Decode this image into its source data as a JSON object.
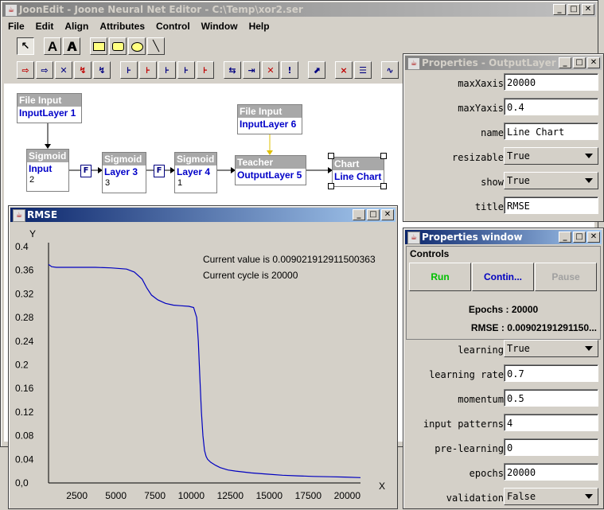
{
  "main_window": {
    "title": "JoonEdit - Joone Neural Net Editor - C:\\Temp\\xor2.ser",
    "menus": [
      "File",
      "Edit",
      "Align",
      "Attributes",
      "Control",
      "Window",
      "Help"
    ]
  },
  "toolbar": {
    "row1": [
      "arrow-select-tool",
      "text-tool",
      "bold-text-tool",
      "rectangle-tool",
      "rounded-rectangle-tool",
      "ellipse-tool",
      "line-tool"
    ],
    "row1_labels": [
      "",
      "A",
      "A"
    ],
    "row2": [
      "file-input-tool",
      "url-input-tool",
      "excel-input-tool",
      "switch-tool",
      "learning-switch-tool",
      "linear-layer-tool",
      "sigmoid-layer-tool",
      "tanh-layer-tool",
      "logarithmic-layer-tool",
      "context-layer-tool",
      "full-synapse-tool",
      "direct-synapse-tool",
      "delay-synapse-tool",
      "kohonen-synapse-tool",
      "chart-tool",
      "teacher-tool",
      "output-tool",
      "wave-tool"
    ]
  },
  "network": {
    "nodes": [
      {
        "header": "File Input",
        "name": "InputLayer 1",
        "count": ""
      },
      {
        "header": "Sigmoid",
        "name": "Input",
        "count": "2"
      },
      {
        "header": "Sigmoid",
        "name": "Layer 3",
        "count": "3"
      },
      {
        "header": "Sigmoid",
        "name": "Layer 4",
        "count": "1"
      },
      {
        "header": "File Input",
        "name": "InputLayer 6",
        "count": ""
      },
      {
        "header": "Teacher",
        "name": "OutputLayer 5",
        "count": ""
      },
      {
        "header": "Chart",
        "name": "Line Chart",
        "count": ""
      }
    ],
    "synapse_label": "F"
  },
  "rmse_window": {
    "title": "RMSE",
    "y_axis_label": "Y",
    "x_axis_label": "X",
    "current_value_text": "Current value is 0.009021912911500363",
    "current_cycle_text": "Current cycle is 20000"
  },
  "chart_data": {
    "type": "line",
    "title": "RMSE",
    "xlabel": "X",
    "ylabel": "Y",
    "xlim": [
      0,
      20000
    ],
    "ylim": [
      0,
      0.4
    ],
    "x_ticks": [
      "2500",
      "5000",
      "7500",
      "10000",
      "12500",
      "15000",
      "17500",
      "20000"
    ],
    "y_ticks": [
      "0,0",
      "0.04",
      "0.08",
      "0.12",
      "0.16",
      "0.2",
      "0.24",
      "0.28",
      "0.32",
      "0.36",
      "0.4"
    ],
    "line_color": "#0000c0",
    "series": [
      {
        "x": [
          0,
          200,
          500,
          1000,
          2000,
          3000,
          4000,
          5000,
          5500,
          6000,
          6300,
          6600,
          7000,
          7500,
          8000,
          8500,
          9000,
          9300,
          9500,
          9600,
          9700,
          9800,
          9900,
          10000,
          10100,
          10200,
          10400,
          10700,
          11000,
          11500,
          12000,
          13000,
          14000,
          15000,
          16000,
          17000,
          18000,
          19000,
          20000
        ],
        "y": [
          0.37,
          0.366,
          0.365,
          0.365,
          0.365,
          0.365,
          0.364,
          0.362,
          0.357,
          0.345,
          0.33,
          0.318,
          0.31,
          0.304,
          0.301,
          0.3,
          0.299,
          0.297,
          0.28,
          0.24,
          0.18,
          0.12,
          0.08,
          0.055,
          0.045,
          0.04,
          0.035,
          0.03,
          0.026,
          0.022,
          0.02,
          0.017,
          0.015,
          0.013,
          0.012,
          0.011,
          0.0105,
          0.01,
          0.009
        ]
      }
    ]
  },
  "output_props": {
    "title": "Properties - OutputLayer 1",
    "rows": [
      {
        "label": "maxXaxis",
        "value": "20000",
        "kind": "field"
      },
      {
        "label": "maxYaxis",
        "value": "0.4",
        "kind": "field"
      },
      {
        "label": "name",
        "value": "Line Chart",
        "kind": "field"
      },
      {
        "label": "resizable",
        "value": "True",
        "kind": "combo"
      },
      {
        "label": "show",
        "value": "True",
        "kind": "combo"
      },
      {
        "label": "title",
        "value": "RMSE",
        "kind": "field"
      }
    ]
  },
  "props_window": {
    "title": "Properties window",
    "controls_label": "Controls",
    "run_label": "Run",
    "continue_label": "Contin...",
    "pause_label": "Pause",
    "epochs_text": "Epochs : 20000",
    "rmse_text": "RMSE : 0.00902191291150...",
    "rows": [
      {
        "label": "learning",
        "value": "True",
        "kind": "combo"
      },
      {
        "label": "learning rate",
        "value": "0.7",
        "kind": "field"
      },
      {
        "label": "momentum",
        "value": "0.5",
        "kind": "field"
      },
      {
        "label": "input patterns",
        "value": "4",
        "kind": "field"
      },
      {
        "label": "pre-learning",
        "value": "0",
        "kind": "field"
      },
      {
        "label": "epochs",
        "value": "20000",
        "kind": "field"
      },
      {
        "label": "validation",
        "value": "False",
        "kind": "combo"
      }
    ],
    "colors": {
      "run": "#00c000",
      "continue": "#0000c0",
      "pause": "#a0a0a0"
    }
  }
}
